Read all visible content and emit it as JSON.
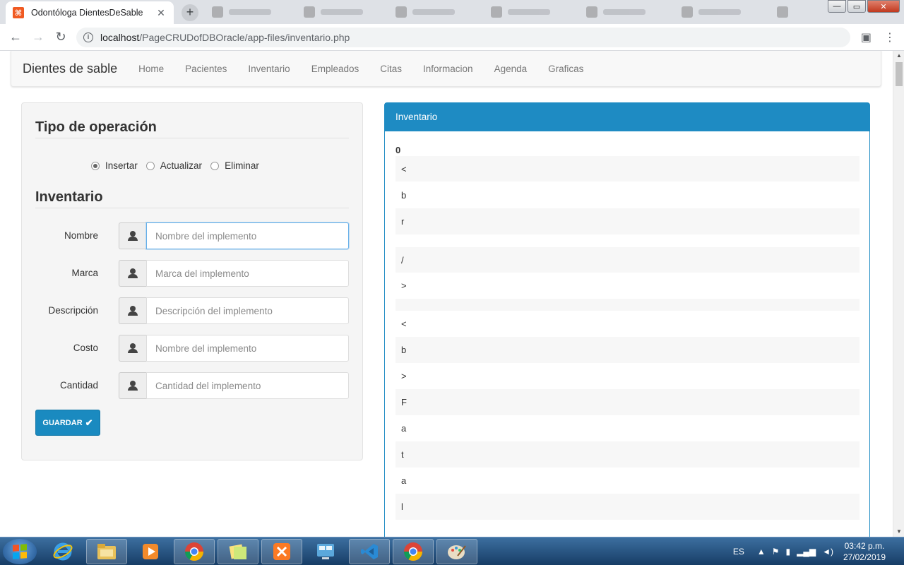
{
  "browser": {
    "tab_title": "Odontóloga DientesDeSable",
    "tab_close": "✕",
    "new_tab": "+",
    "url_host": "localhost",
    "url_path": "/PageCRUDofDBOracle/app-files/inventario.php",
    "window_minimize": "—",
    "window_maximize": "▭",
    "window_close": "✕"
  },
  "navbar": {
    "brand": "Dientes de sable",
    "links": [
      "Home",
      "Pacientes",
      "Inventario",
      "Empleados",
      "Citas",
      "Informacion",
      "Agenda",
      "Graficas"
    ]
  },
  "form": {
    "operation_title": "Tipo de operación",
    "operations": [
      {
        "label": "Insertar",
        "checked": true
      },
      {
        "label": "Actualizar",
        "checked": false
      },
      {
        "label": "Eliminar",
        "checked": false
      }
    ],
    "section_title": "Inventario",
    "fields": [
      {
        "label": "Nombre",
        "placeholder": "Nombre del implemento",
        "focused": true
      },
      {
        "label": "Marca",
        "placeholder": "Marca del implemento",
        "focused": false
      },
      {
        "label": "Descripción",
        "placeholder": "Descripción del implemento",
        "focused": false
      },
      {
        "label": "Costo",
        "placeholder": "Nombre del implemento",
        "focused": false
      },
      {
        "label": "Cantidad",
        "placeholder": "Cantidad del implemento",
        "focused": false
      }
    ],
    "save_label": "GUARDAR"
  },
  "inventory": {
    "heading": "Inventario",
    "key": "0",
    "rows": [
      "<",
      "b",
      "r",
      "",
      "/",
      ">",
      "",
      "<",
      "b",
      ">",
      "F",
      "a",
      "t",
      "a",
      "l"
    ]
  },
  "taskbar": {
    "language": "ES",
    "time": "03:42 p.m.",
    "date": "27/02/2019"
  },
  "colors": {
    "accent": "#1e8bc3",
    "button": "#1a8ac0",
    "favicon": "#f05a22"
  }
}
